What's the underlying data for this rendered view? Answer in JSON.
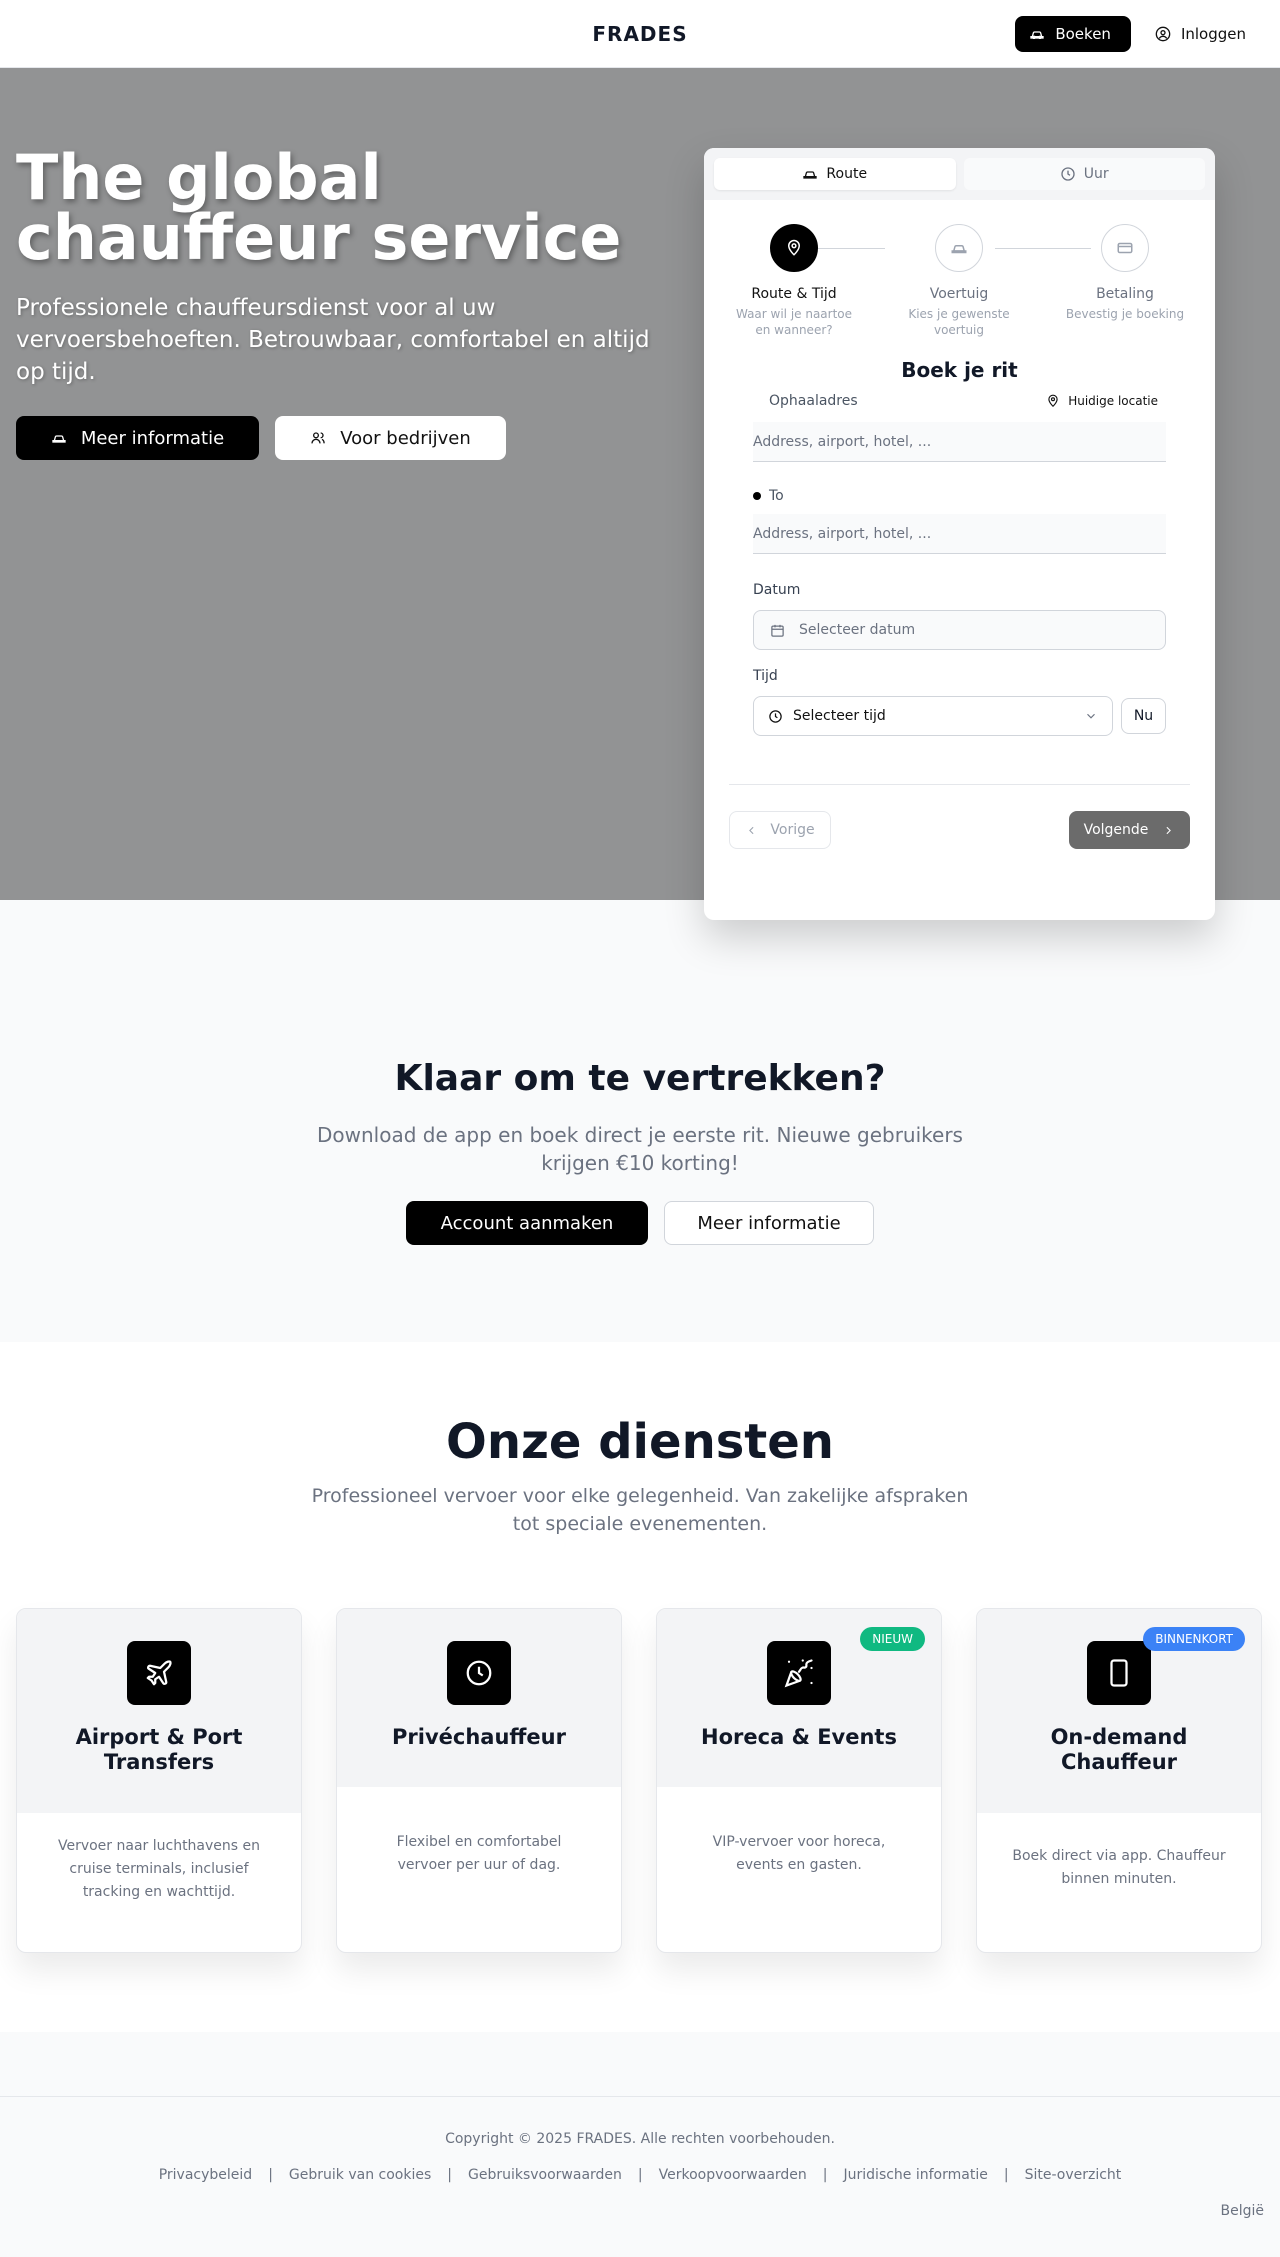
{
  "header": {
    "brand": "FRADES",
    "book_label": "Boeken",
    "login_label": "Inloggen"
  },
  "hero": {
    "title_line1": "The global",
    "title_line2": "chauffeur service",
    "subtitle": "Professionele chauffeursdienst voor al uw vervoersbehoeften. Betrouwbaar, comfortabel en altijd op tijd.",
    "btn_info": "Meer informatie",
    "btn_business": "Voor bedrijven"
  },
  "booking": {
    "tabs": [
      {
        "label": "Route",
        "icon": "car-icon",
        "active": true
      },
      {
        "label": "Uur",
        "icon": "clock-icon",
        "active": false
      }
    ],
    "steps": [
      {
        "label": "Route & Tijd",
        "desc": "Waar wil je naartoe en wanneer?",
        "icon": "map-pin-icon"
      },
      {
        "label": "Voertuig",
        "desc": "Kies je gewenste voertuig",
        "icon": "car-icon"
      },
      {
        "label": "Betaling",
        "desc": "Bevestig je boeking",
        "icon": "credit-card-icon"
      }
    ],
    "form_title": "Boek je rit",
    "pickup_label": "Ophaaladres",
    "current_location": "Huidige locatie",
    "pickup_placeholder": "Address, airport, hotel, ...",
    "to_label": "To",
    "to_placeholder": "Address, airport, hotel, ...",
    "date_label": "Datum",
    "date_placeholder": "Selecteer datum",
    "time_label": "Tijd",
    "time_placeholder": "Selecteer tijd",
    "now_label": "Nu",
    "prev_label": "Vorige",
    "next_label": "Volgende"
  },
  "cta": {
    "title": "Klaar om te vertrekken?",
    "subtitle": "Download de app en boek direct je eerste rit. Nieuwe gebruikers krijgen €10 korting!",
    "btn_account": "Account aanmaken",
    "btn_info": "Meer informatie"
  },
  "services": {
    "title": "Onze diensten",
    "subtitle": "Professioneel vervoer voor elke gelegenheid. Van zakelijke afspraken tot speciale evenementen.",
    "items": [
      {
        "name": "Airport & Port Transfers",
        "desc": "Vervoer naar luchthavens en cruise terminals, inclusief tracking en wachttijd.",
        "icon": "plane-icon",
        "badge": ""
      },
      {
        "name": "Privéchauffeur",
        "desc": "Flexibel en comfortabel vervoer per uur of dag.",
        "icon": "clock-icon",
        "badge": ""
      },
      {
        "name": "Horeca & Events",
        "desc": "VIP-vervoer voor horeca, events en gasten.",
        "icon": "party-popper-icon",
        "badge": "NIEUW",
        "badge_color": "#10b981"
      },
      {
        "name": "On-demand Chauffeur",
        "desc": "Boek direct via app. Chauffeur binnen minuten.",
        "icon": "smartphone-icon",
        "badge": "BINNENKORT",
        "badge_color": "#3b82f6"
      }
    ]
  },
  "footer": {
    "copyright": "Copyright © 2025 FRADES. Alle rechten voorbehouden.",
    "links": [
      "Privacybeleid",
      "Gebruik van cookies",
      "Gebruiksvoorwaarden",
      "Verkoopvoorwaarden",
      "Juridische informatie",
      "Site-overzicht"
    ],
    "separator": "|",
    "region": "België"
  },
  "colors": {
    "hero_bg": "#929394",
    "primary": "#000000",
    "badge_new": "#10b981",
    "badge_soon": "#3b82f6"
  }
}
